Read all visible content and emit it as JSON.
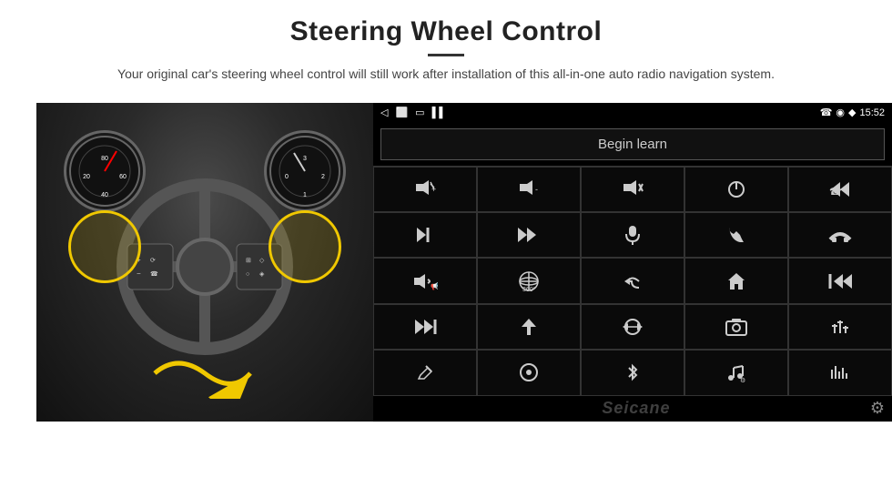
{
  "header": {
    "title": "Steering Wheel Control",
    "subtitle": "Your original car's steering wheel control will still work after installation of this all-in-one auto radio navigation system."
  },
  "status_bar": {
    "time": "15:52",
    "back_icon": "◁",
    "home_icon": "⬜",
    "overview_icon": "▭",
    "signal_icon": "▌▌",
    "wifi_icon": "◆",
    "phone_icon": "📞",
    "location_icon": "◉"
  },
  "begin_learn": {
    "label": "Begin learn"
  },
  "controls": [
    {
      "icon": "🔊+",
      "name": "vol-up"
    },
    {
      "icon": "🔊-",
      "name": "vol-down"
    },
    {
      "icon": "🔇",
      "name": "mute"
    },
    {
      "icon": "⏻",
      "name": "power"
    },
    {
      "icon": "⏮",
      "name": "prev-track-phone"
    },
    {
      "icon": "⏭",
      "name": "next"
    },
    {
      "icon": "✂⏭",
      "name": "fast-forward"
    },
    {
      "icon": "🎤",
      "name": "mic"
    },
    {
      "icon": "📞",
      "name": "call"
    },
    {
      "icon": "📞↩",
      "name": "hang-up"
    },
    {
      "icon": "📢",
      "name": "speaker"
    },
    {
      "icon": "⊕360",
      "name": "360-view"
    },
    {
      "icon": "↩",
      "name": "back"
    },
    {
      "icon": "⌂",
      "name": "home"
    },
    {
      "icon": "⏮⏮",
      "name": "prev-track"
    },
    {
      "icon": "⏭⏭",
      "name": "fast-fwd2"
    },
    {
      "icon": "➤",
      "name": "nav"
    },
    {
      "icon": "⇌",
      "name": "switch"
    },
    {
      "icon": "📷",
      "name": "camera"
    },
    {
      "icon": "⏺",
      "name": "equalizer"
    },
    {
      "icon": "✏",
      "name": "edit"
    },
    {
      "icon": "◎",
      "name": "settings2"
    },
    {
      "icon": "✶",
      "name": "bluetooth"
    },
    {
      "icon": "🎵",
      "name": "music"
    },
    {
      "icon": "|||",
      "name": "spectrum"
    }
  ],
  "watermark": "Seicane",
  "gear_label": "⚙"
}
